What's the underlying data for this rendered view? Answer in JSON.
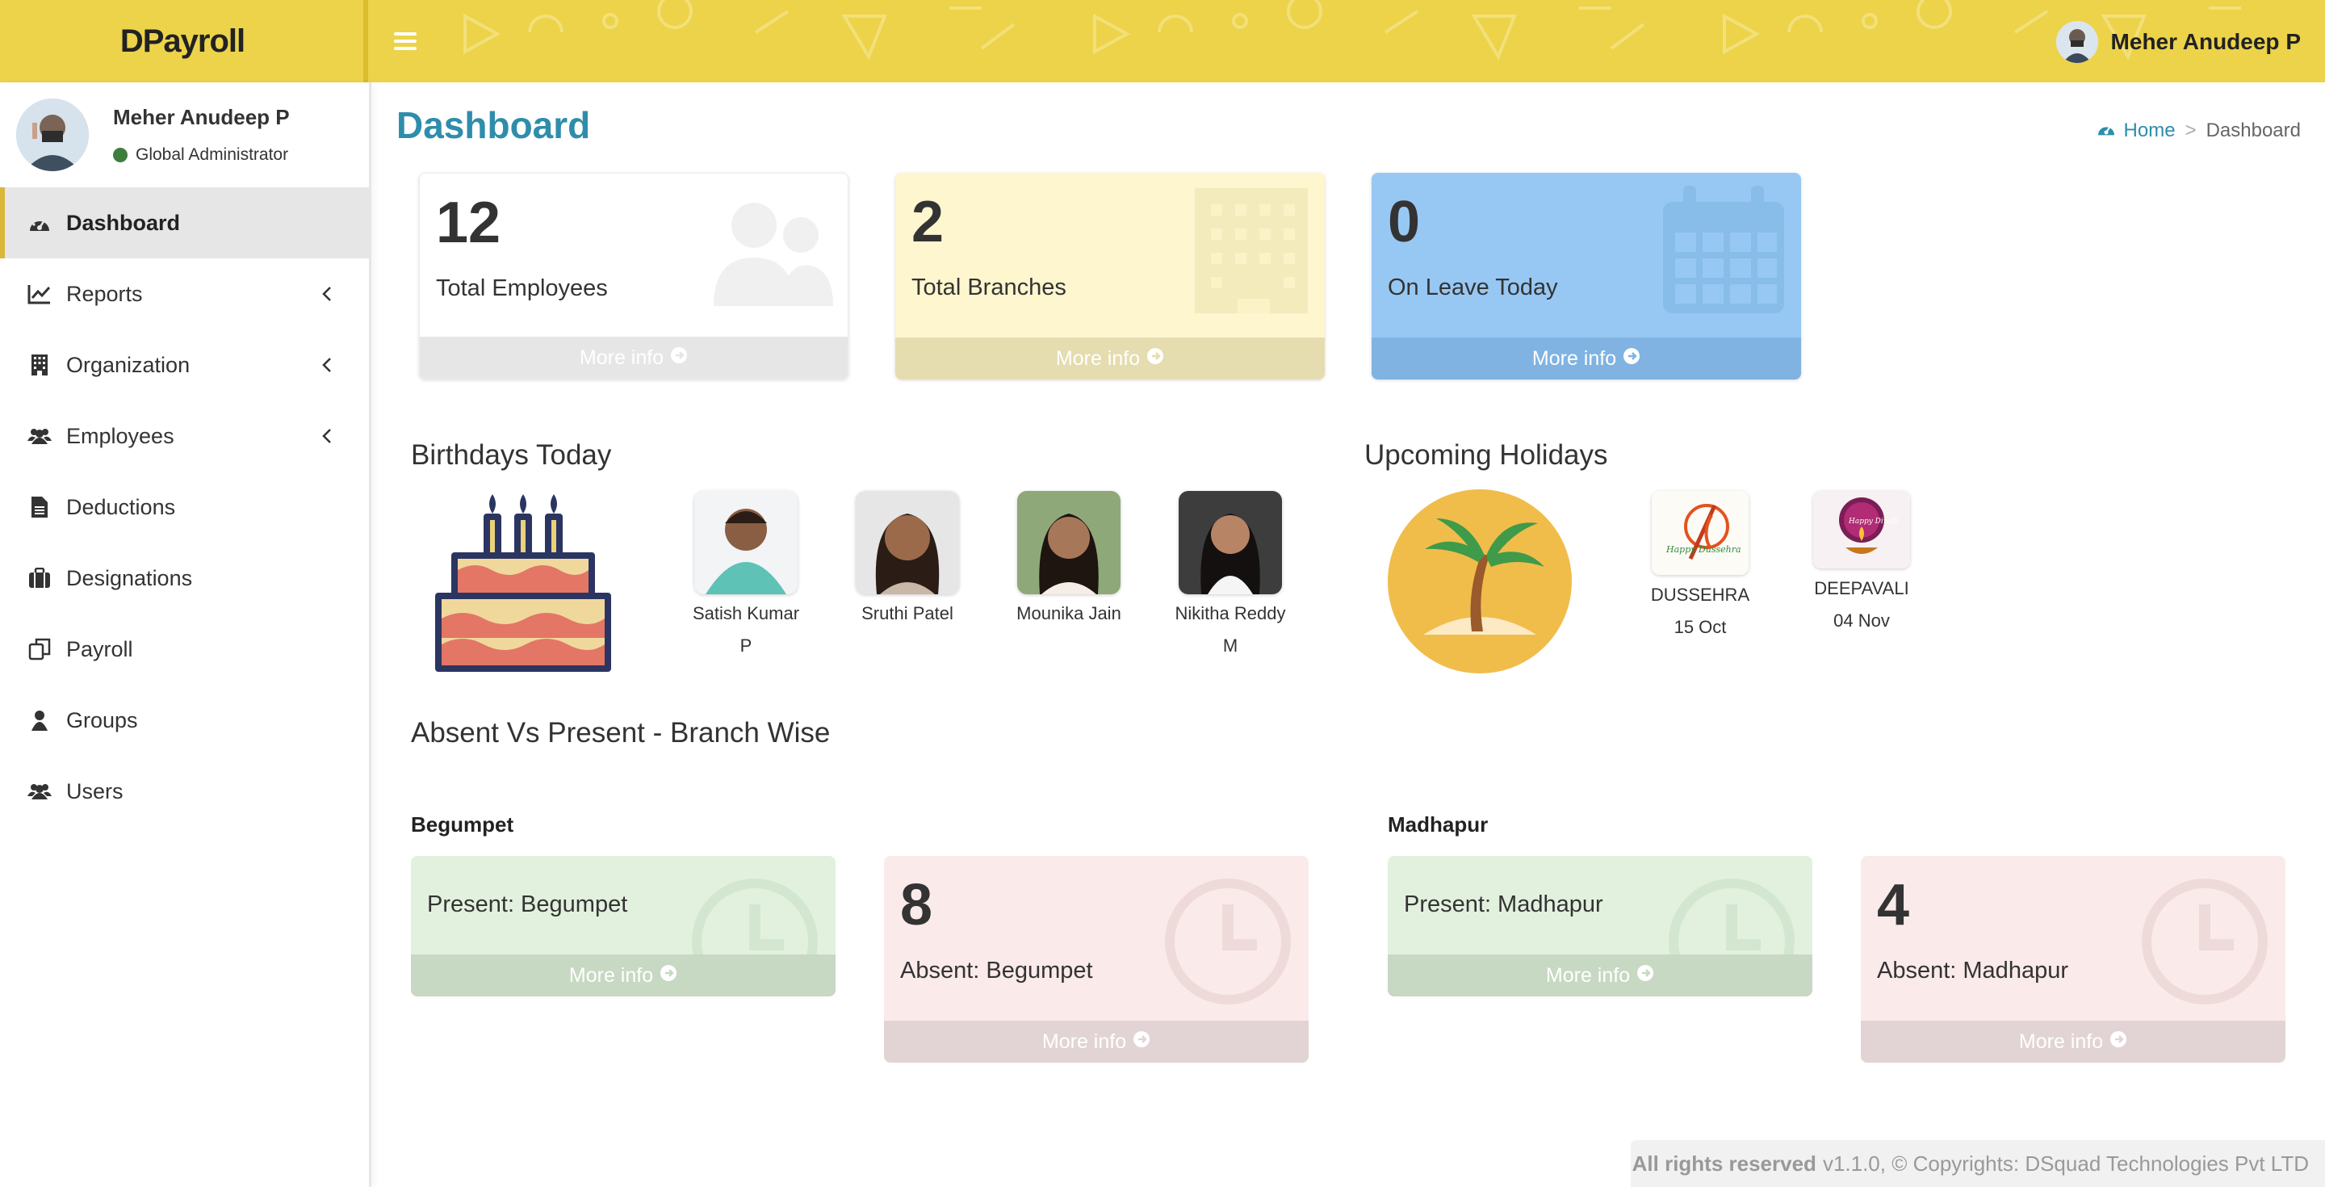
{
  "app": {
    "brand": "DPayroll"
  },
  "header": {
    "user_name": "Meher Anudeep P"
  },
  "sidebar": {
    "user": {
      "name": "Meher Anudeep P",
      "role": "Global Administrator"
    },
    "items": [
      {
        "label": "Dashboard",
        "icon": "dashboard-icon",
        "active": true
      },
      {
        "label": "Reports",
        "icon": "line-chart-icon",
        "has_submenu": true
      },
      {
        "label": "Organization",
        "icon": "building-icon",
        "has_submenu": true
      },
      {
        "label": "Employees",
        "icon": "users-icon",
        "has_submenu": true
      },
      {
        "label": "Deductions",
        "icon": "document-icon"
      },
      {
        "label": "Designations",
        "icon": "briefcase-icon"
      },
      {
        "label": "Payroll",
        "icon": "copy-icon"
      },
      {
        "label": "Groups",
        "icon": "user-icon"
      },
      {
        "label": "Users",
        "icon": "users-icon"
      }
    ]
  },
  "page": {
    "title": "Dashboard",
    "breadcrumb": {
      "home": "Home",
      "separator": ">",
      "current": "Dashboard"
    }
  },
  "stats": [
    {
      "value": "12",
      "label": "Total Employees",
      "more": "More info"
    },
    {
      "value": "2",
      "label": "Total Branches",
      "more": "More info"
    },
    {
      "value": "0",
      "label": "On Leave Today",
      "more": "More info"
    }
  ],
  "birthdays": {
    "title": "Birthdays Today",
    "people": [
      {
        "name": "Satish Kumar P"
      },
      {
        "name": "Sruthi Patel"
      },
      {
        "name": "Mounika Jain"
      },
      {
        "name": "Nikitha Reddy M"
      }
    ]
  },
  "holidays": {
    "title": "Upcoming Holidays",
    "items": [
      {
        "name": "DUSSEHRA",
        "date": "15 Oct",
        "image_text": "Happy Dussehra"
      },
      {
        "name": "DEEPAVALI",
        "date": "04 Nov",
        "image_text": "Happy Diwali"
      }
    ]
  },
  "attendance": {
    "title": "Absent Vs Present - Branch Wise",
    "branches": [
      {
        "name": "Begumpet",
        "present_label": "Present: Begumpet",
        "absent_value": "8",
        "absent_label": "Absent: Begumpet",
        "more": "More info"
      },
      {
        "name": "Madhapur",
        "present_label": "Present: Madhapur",
        "absent_value": "4",
        "absent_label": "Absent: Madhapur",
        "more": "More info"
      }
    ]
  },
  "footer": {
    "bold": "All rights reserved",
    "text": "v1.1.0, © Copyrights: DSquad Technologies Pvt LTD"
  },
  "colors": {
    "topbar": "#ecd34a",
    "accent": "#2e8dab",
    "active_border": "#d8b73a"
  }
}
